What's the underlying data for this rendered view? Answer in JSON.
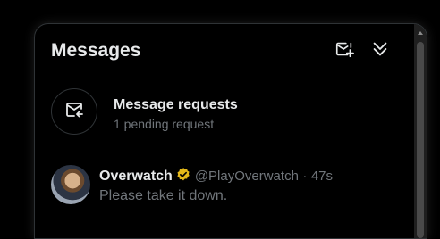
{
  "header": {
    "title": "Messages",
    "new_message_icon": "new-message-icon",
    "collapse_icon": "double-chevron-down-icon"
  },
  "requests": {
    "title": "Message requests",
    "subtitle": "1 pending request",
    "icon": "envelope-arrow-icon"
  },
  "conversation": {
    "name": "Overwatch",
    "handle": "@PlayOverwatch",
    "separator": "·",
    "time": "47s",
    "message": "Please take it down.",
    "verified_color": "#e2b719"
  },
  "colors": {
    "background": "#000000",
    "text_primary": "#e7e9ea",
    "text_secondary": "#71767b",
    "border": "#2f3336"
  }
}
